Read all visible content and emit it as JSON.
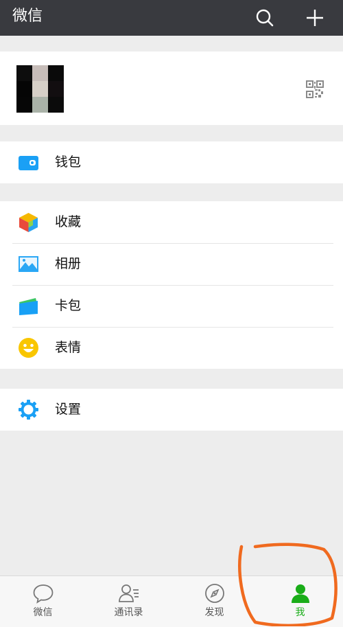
{
  "header": {
    "title": "微信",
    "search_icon": "search-icon",
    "add_icon": "plus-icon"
  },
  "profile": {
    "avatar": "pixelated-avatar",
    "qr_icon": "qr-code-icon"
  },
  "menu": {
    "wallet": {
      "label": "钱包",
      "icon": "wallet-icon",
      "color": "#1aa0f5"
    },
    "favorites": {
      "label": "收藏",
      "icon": "cube-icon"
    },
    "album": {
      "label": "相册",
      "icon": "photo-icon",
      "color": "#2aa7f5"
    },
    "cards": {
      "label": "卡包",
      "icon": "card-holder-icon"
    },
    "stickers": {
      "label": "表情",
      "icon": "smiley-icon",
      "color": "#f9c600"
    },
    "settings": {
      "label": "设置",
      "icon": "gear-icon",
      "color": "#1aa0f5"
    }
  },
  "tabs": [
    {
      "label": "微信",
      "icon": "chat-bubble-icon",
      "active": false
    },
    {
      "label": "通讯录",
      "icon": "contacts-icon",
      "active": false
    },
    {
      "label": "发现",
      "icon": "compass-icon",
      "active": false
    },
    {
      "label": "我",
      "icon": "person-icon",
      "active": true
    }
  ],
  "accent_color": "#1aad19",
  "annotation_color": "#f06a1f"
}
